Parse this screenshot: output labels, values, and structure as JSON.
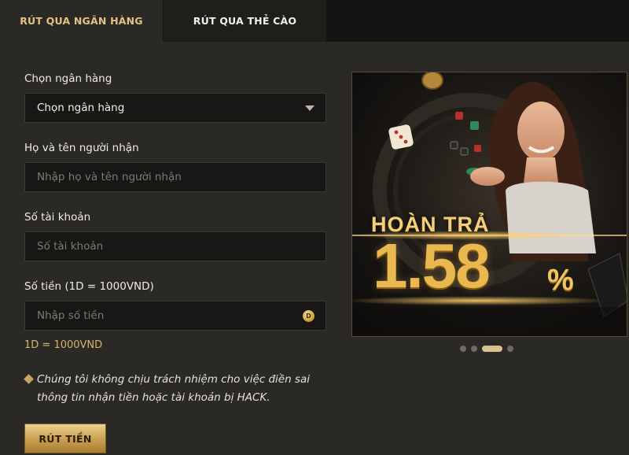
{
  "tabs": [
    {
      "label": "RÚT QUA NGÂN HÀNG",
      "active": true
    },
    {
      "label": "RÚT QUA THẺ CÀO",
      "active": false
    }
  ],
  "form": {
    "bank": {
      "label": "Chọn ngân hàng",
      "value": "Chọn ngân hàng"
    },
    "recipient": {
      "label": "Họ và tên người nhận",
      "placeholder": "Nhập họ và tên người nhận"
    },
    "account": {
      "label": "Số tài khoản",
      "placeholder": "Số tài khoản"
    },
    "amount": {
      "label": "Số tiền (1D = 1000VND)",
      "placeholder": "Nhập số tiền",
      "currency_badge": "D"
    },
    "rate_note": "1D = 1000VND",
    "notice": "Chúng tôi không chịu trách nhiệm cho việc điền sai thông tin nhận tiền hoặc tài khoản bị HACK.",
    "submit_label": "RÚT TIỀN"
  },
  "banner": {
    "headline": "HOÀN TRẢ",
    "number": "1.58",
    "percent": "%",
    "slides": 4,
    "active_slide": 3
  },
  "colors": {
    "background": "#2b2925",
    "gold": "#d8b46a",
    "tab_active_text": "#e2c384"
  }
}
